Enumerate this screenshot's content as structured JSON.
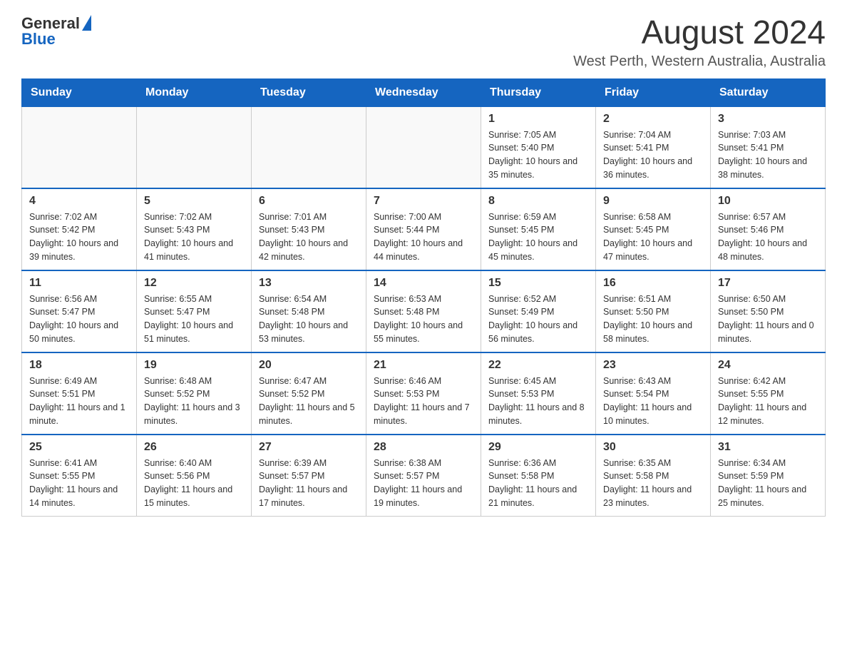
{
  "logo": {
    "general": "General",
    "blue": "Blue"
  },
  "title": "August 2024",
  "subtitle": "West Perth, Western Australia, Australia",
  "days_of_week": [
    "Sunday",
    "Monday",
    "Tuesday",
    "Wednesday",
    "Thursday",
    "Friday",
    "Saturday"
  ],
  "weeks": [
    [
      {
        "day": "",
        "info": ""
      },
      {
        "day": "",
        "info": ""
      },
      {
        "day": "",
        "info": ""
      },
      {
        "day": "",
        "info": ""
      },
      {
        "day": "1",
        "info": "Sunrise: 7:05 AM\nSunset: 5:40 PM\nDaylight: 10 hours and 35 minutes."
      },
      {
        "day": "2",
        "info": "Sunrise: 7:04 AM\nSunset: 5:41 PM\nDaylight: 10 hours and 36 minutes."
      },
      {
        "day": "3",
        "info": "Sunrise: 7:03 AM\nSunset: 5:41 PM\nDaylight: 10 hours and 38 minutes."
      }
    ],
    [
      {
        "day": "4",
        "info": "Sunrise: 7:02 AM\nSunset: 5:42 PM\nDaylight: 10 hours and 39 minutes."
      },
      {
        "day": "5",
        "info": "Sunrise: 7:02 AM\nSunset: 5:43 PM\nDaylight: 10 hours and 41 minutes."
      },
      {
        "day": "6",
        "info": "Sunrise: 7:01 AM\nSunset: 5:43 PM\nDaylight: 10 hours and 42 minutes."
      },
      {
        "day": "7",
        "info": "Sunrise: 7:00 AM\nSunset: 5:44 PM\nDaylight: 10 hours and 44 minutes."
      },
      {
        "day": "8",
        "info": "Sunrise: 6:59 AM\nSunset: 5:45 PM\nDaylight: 10 hours and 45 minutes."
      },
      {
        "day": "9",
        "info": "Sunrise: 6:58 AM\nSunset: 5:45 PM\nDaylight: 10 hours and 47 minutes."
      },
      {
        "day": "10",
        "info": "Sunrise: 6:57 AM\nSunset: 5:46 PM\nDaylight: 10 hours and 48 minutes."
      }
    ],
    [
      {
        "day": "11",
        "info": "Sunrise: 6:56 AM\nSunset: 5:47 PM\nDaylight: 10 hours and 50 minutes."
      },
      {
        "day": "12",
        "info": "Sunrise: 6:55 AM\nSunset: 5:47 PM\nDaylight: 10 hours and 51 minutes."
      },
      {
        "day": "13",
        "info": "Sunrise: 6:54 AM\nSunset: 5:48 PM\nDaylight: 10 hours and 53 minutes."
      },
      {
        "day": "14",
        "info": "Sunrise: 6:53 AM\nSunset: 5:48 PM\nDaylight: 10 hours and 55 minutes."
      },
      {
        "day": "15",
        "info": "Sunrise: 6:52 AM\nSunset: 5:49 PM\nDaylight: 10 hours and 56 minutes."
      },
      {
        "day": "16",
        "info": "Sunrise: 6:51 AM\nSunset: 5:50 PM\nDaylight: 10 hours and 58 minutes."
      },
      {
        "day": "17",
        "info": "Sunrise: 6:50 AM\nSunset: 5:50 PM\nDaylight: 11 hours and 0 minutes."
      }
    ],
    [
      {
        "day": "18",
        "info": "Sunrise: 6:49 AM\nSunset: 5:51 PM\nDaylight: 11 hours and 1 minute."
      },
      {
        "day": "19",
        "info": "Sunrise: 6:48 AM\nSunset: 5:52 PM\nDaylight: 11 hours and 3 minutes."
      },
      {
        "day": "20",
        "info": "Sunrise: 6:47 AM\nSunset: 5:52 PM\nDaylight: 11 hours and 5 minutes."
      },
      {
        "day": "21",
        "info": "Sunrise: 6:46 AM\nSunset: 5:53 PM\nDaylight: 11 hours and 7 minutes."
      },
      {
        "day": "22",
        "info": "Sunrise: 6:45 AM\nSunset: 5:53 PM\nDaylight: 11 hours and 8 minutes."
      },
      {
        "day": "23",
        "info": "Sunrise: 6:43 AM\nSunset: 5:54 PM\nDaylight: 11 hours and 10 minutes."
      },
      {
        "day": "24",
        "info": "Sunrise: 6:42 AM\nSunset: 5:55 PM\nDaylight: 11 hours and 12 minutes."
      }
    ],
    [
      {
        "day": "25",
        "info": "Sunrise: 6:41 AM\nSunset: 5:55 PM\nDaylight: 11 hours and 14 minutes."
      },
      {
        "day": "26",
        "info": "Sunrise: 6:40 AM\nSunset: 5:56 PM\nDaylight: 11 hours and 15 minutes."
      },
      {
        "day": "27",
        "info": "Sunrise: 6:39 AM\nSunset: 5:57 PM\nDaylight: 11 hours and 17 minutes."
      },
      {
        "day": "28",
        "info": "Sunrise: 6:38 AM\nSunset: 5:57 PM\nDaylight: 11 hours and 19 minutes."
      },
      {
        "day": "29",
        "info": "Sunrise: 6:36 AM\nSunset: 5:58 PM\nDaylight: 11 hours and 21 minutes."
      },
      {
        "day": "30",
        "info": "Sunrise: 6:35 AM\nSunset: 5:58 PM\nDaylight: 11 hours and 23 minutes."
      },
      {
        "day": "31",
        "info": "Sunrise: 6:34 AM\nSunset: 5:59 PM\nDaylight: 11 hours and 25 minutes."
      }
    ]
  ]
}
